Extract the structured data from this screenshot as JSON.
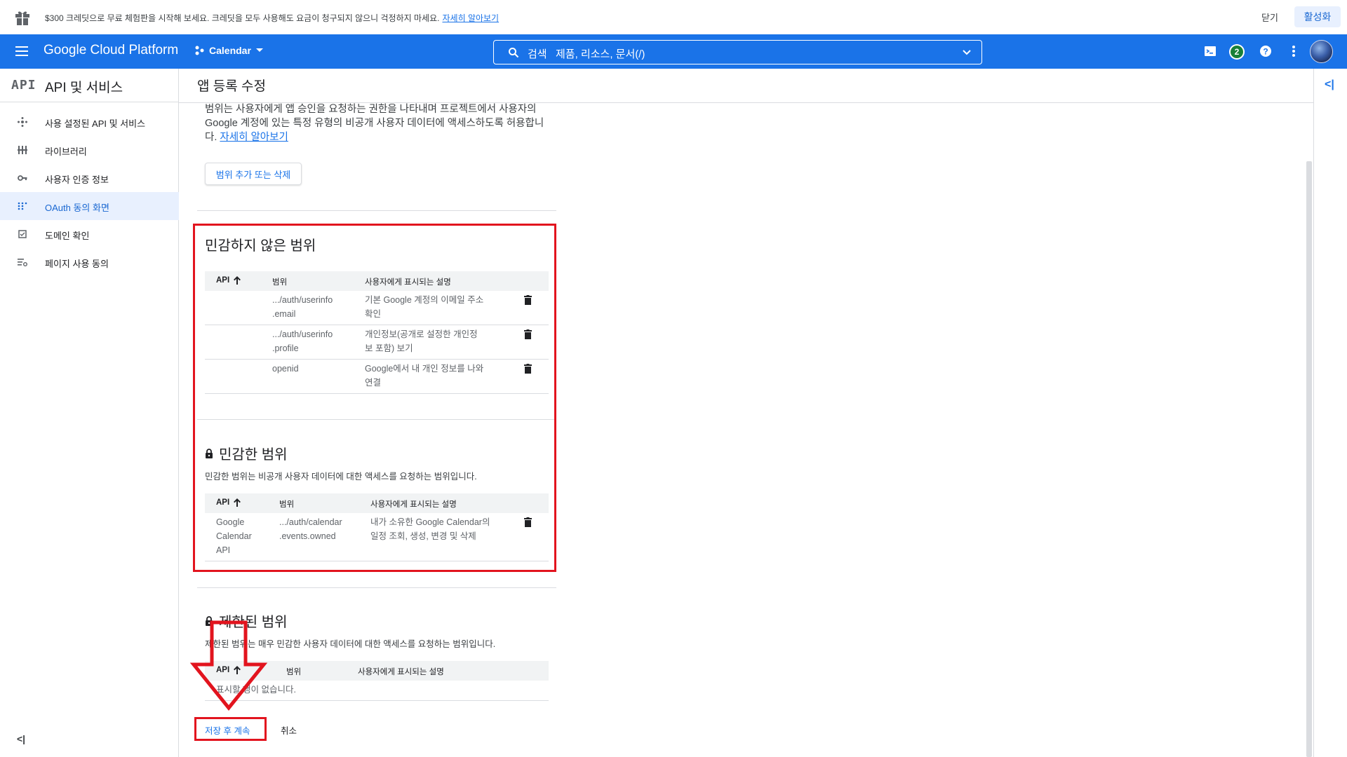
{
  "promo": {
    "message": "$300 크레딧으로 무료 체험판을 시작해 보세요. 크레딧을 모두 사용해도 요금이 청구되지 않으니 걱정하지 마세요.",
    "link": "자세히 알아보기",
    "close": "닫기",
    "activate": "활성화"
  },
  "header": {
    "brand": "Google Cloud Platform",
    "project": "Calendar",
    "search_label": "검색",
    "search_placeholder": "제품, 리소스, 문서(/)",
    "notification_count": "2"
  },
  "sidebar": {
    "logo": "API",
    "title": "API 및 서비스",
    "items": [
      {
        "label": "사용 설정된 API 및 서비스",
        "icon": "api-hub-icon"
      },
      {
        "label": "라이브러리",
        "icon": "library-grid-icon"
      },
      {
        "label": "사용자 인증 정보",
        "icon": "key-icon"
      },
      {
        "label": "OAuth 동의 화면",
        "icon": "consent-dots-icon"
      },
      {
        "label": "도메인 확인",
        "icon": "domain-check-icon"
      },
      {
        "label": "페이지 사용 동의",
        "icon": "settings-list-icon"
      }
    ],
    "collapse": "<|"
  },
  "main": {
    "title": "앱 등록 수정",
    "intro_text": "범위는 사용자에게 앱 승인을 요청하는 권한을 나타내며 프로젝트에서 사용자의 Google 계정에 있는 특정 유형의 비공개 사용자 데이터에 액세스하도록 허용합니다.",
    "intro_link": "자세히 알아보기",
    "add_scope_button": "범위 추가 또는 삭제",
    "non_sensitive": {
      "title": "민감하지 않은 범위",
      "headers": {
        "api": "API",
        "scope": "범위",
        "desc": "사용자에게 표시되는 설명"
      },
      "rows": [
        {
          "api": "",
          "scope1": ".../auth/userinfo",
          "scope2": ".email",
          "desc1": "기본 Google 계정의 이메일 주소",
          "desc2": "확인"
        },
        {
          "api": "",
          "scope1": ".../auth/userinfo",
          "scope2": ".profile",
          "desc1": "개인정보(공개로 설정한 개인정",
          "desc2": "보 포함) 보기"
        },
        {
          "api": "",
          "scope1": "openid",
          "scope2": "",
          "desc1": "Google에서 내 개인 정보를 나와",
          "desc2": "연결"
        }
      ]
    },
    "sensitive": {
      "title": "민감한 범위",
      "description": "민감한 범위는 비공개 사용자 데이터에 대한 액세스를 요청하는 범위입니다.",
      "headers": {
        "api": "API",
        "scope": "범위",
        "desc": "사용자에게 표시되는 설명"
      },
      "rows": [
        {
          "api1": "Google",
          "api2": "Calendar",
          "api3": "API",
          "scope1": ".../auth/calendar",
          "scope2": ".events.owned",
          "desc1": "내가 소유한 Google Calendar의",
          "desc2": "일정 조회, 생성, 변경 및 삭제"
        }
      ]
    },
    "restricted": {
      "title": "제한된 범위",
      "description": "제한된 범위는 매우 민감한 사용자 데이터에 대한 액세스를 요청하는 범위입니다.",
      "headers": {
        "api": "API",
        "scope": "범위",
        "desc": "사용자에게 표시되는 설명"
      },
      "empty": "표시할 행이 없습니다."
    },
    "save_button": "저장 후 계속",
    "cancel_button": "취소"
  },
  "colors": {
    "accent": "#1a73e8",
    "highlight": "#e2141e"
  }
}
